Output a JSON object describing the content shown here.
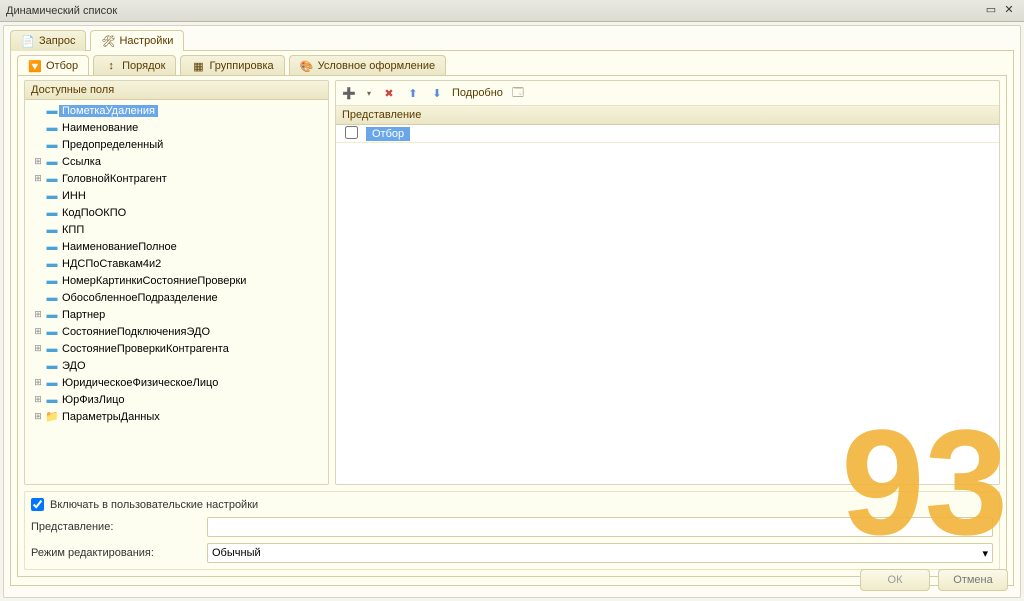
{
  "window": {
    "title": "Динамический список"
  },
  "tabs": {
    "query": "Запрос",
    "settings": "Настройки"
  },
  "innerTabs": {
    "filter": "Отбор",
    "order": "Порядок",
    "group": "Группировка",
    "cond": "Условное оформление"
  },
  "left": {
    "header": "Доступные поля",
    "items": [
      {
        "exp": "",
        "label": "ПометкаУдаления",
        "selected": true
      },
      {
        "exp": "",
        "label": "Наименование"
      },
      {
        "exp": "",
        "label": "Предопределенный"
      },
      {
        "exp": "+",
        "label": "Ссылка"
      },
      {
        "exp": "+",
        "label": "ГоловнойКонтрагент"
      },
      {
        "exp": "",
        "label": "ИНН"
      },
      {
        "exp": "",
        "label": "КодПоОКПО"
      },
      {
        "exp": "",
        "label": "КПП"
      },
      {
        "exp": "",
        "label": "НаименованиеПолное"
      },
      {
        "exp": "",
        "label": "НДСПоСтавкам4и2"
      },
      {
        "exp": "",
        "label": "НомерКартинкиСостояниеПроверки"
      },
      {
        "exp": "",
        "label": "ОбособленноеПодразделение"
      },
      {
        "exp": "+",
        "label": "Партнер"
      },
      {
        "exp": "+",
        "label": "СостояниеПодключенияЭДО"
      },
      {
        "exp": "+",
        "label": "СостояниеПроверкиКонтрагента"
      },
      {
        "exp": "",
        "label": "ЭДО"
      },
      {
        "exp": "+",
        "label": "ЮридическоеФизическоеЛицо"
      },
      {
        "exp": "+",
        "label": "ЮрФизЛицо"
      },
      {
        "exp": "+",
        "label": "ПараметрыДанных",
        "folder": true
      }
    ]
  },
  "right": {
    "toolbar": {
      "details": "Подробно"
    },
    "gridHeader": "Представление",
    "rows": [
      {
        "label": "Отбор"
      }
    ]
  },
  "bottom": {
    "includeLabel": "Включать в пользовательские настройки",
    "includeChecked": true,
    "presentationLabel": "Представление:",
    "presentationValue": "",
    "editModeLabel": "Режим редактирования:",
    "editModeValue": "Обычный"
  },
  "footer": {
    "ok": "ОК",
    "cancel": "Отмена"
  },
  "watermark": "93"
}
